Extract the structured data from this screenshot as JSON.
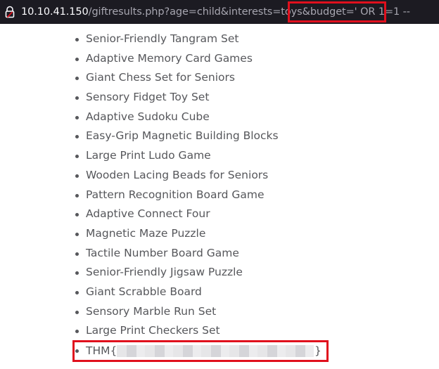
{
  "address_bar": {
    "icon": "lock-icon",
    "host": "10.10.41.150",
    "path": "/giftresults.php?age=child&interests=toys&",
    "injection": "budget=' OR 1=1 --",
    "highlight_color": "#e0101d"
  },
  "gifts": [
    "Senior-Friendly Tangram Set",
    "Adaptive Memory Card Games",
    "Giant Chess Set for Seniors",
    "Sensory Fidget Toy Set",
    "Adaptive Sudoku Cube",
    "Easy-Grip Magnetic Building Blocks",
    "Large Print Ludo Game",
    "Wooden Lacing Beads for Seniors",
    "Pattern Recognition Board Game",
    "Adaptive Connect Four",
    "Magnetic Maze Puzzle",
    "Tactile Number Board Game",
    "Senior-Friendly Jigsaw Puzzle",
    "Giant Scrabble Board",
    "Sensory Marble Run Set",
    "Large Print Checkers Set"
  ],
  "flag": {
    "prefix": "THM{",
    "suffix": "}"
  }
}
